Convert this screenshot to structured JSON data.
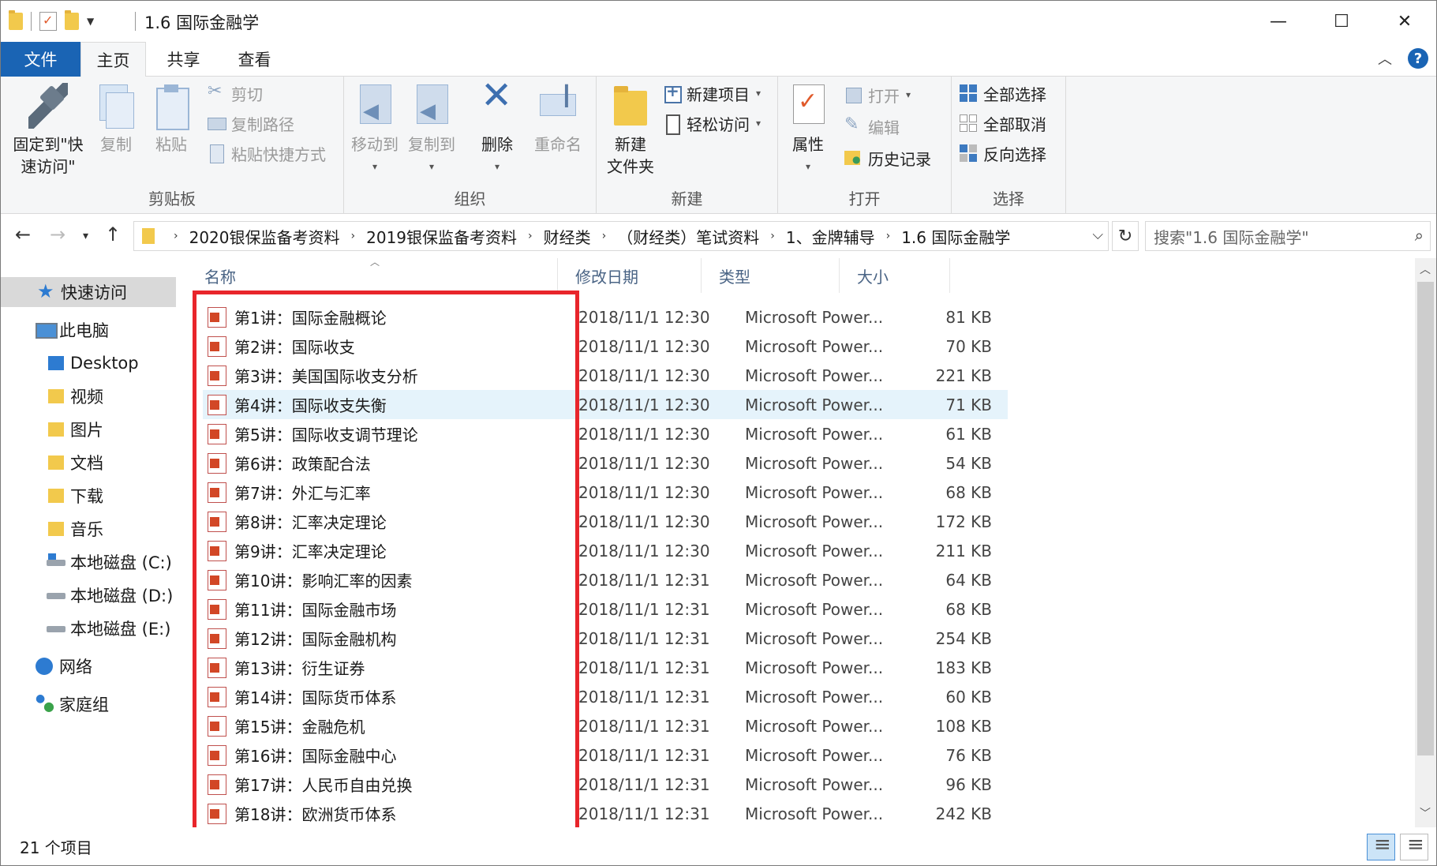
{
  "window": {
    "title": "1.6 国际金融学",
    "controls": {
      "minimize": "—",
      "maximize": "☐",
      "close": "✕"
    }
  },
  "ribbon_tabs": {
    "file": "文件",
    "home": "主页",
    "share": "共享",
    "view": "查看"
  },
  "ribbon": {
    "clipboard": {
      "label": "剪贴板",
      "pin": "固定到\"快速访问\"",
      "copy": "复制",
      "paste": "粘贴",
      "cut": "剪切",
      "copy_path": "复制路径",
      "paste_shortcut": "粘贴快捷方式"
    },
    "organize": {
      "label": "组织",
      "move_to": "移动到",
      "copy_to": "复制到",
      "delete": "删除",
      "rename": "重命名"
    },
    "new": {
      "label": "新建",
      "new_folder": "新建\n文件夹",
      "new_item": "新建项目",
      "easy_access": "轻松访问"
    },
    "open": {
      "label": "打开",
      "properties": "属性",
      "open": "打开",
      "edit": "编辑",
      "history": "历史记录"
    },
    "select": {
      "label": "选择",
      "select_all": "全部选择",
      "select_none": "全部取消",
      "invert": "反向选择"
    }
  },
  "address": {
    "breadcrumbs": [
      "2020银保监备考资料",
      "2019银保监备考资料",
      "财经类",
      "（财经类）笔试资料",
      "1、金牌辅导",
      "1.6 国际金融学"
    ],
    "search_placeholder": "搜索\"1.6 国际金融学\""
  },
  "nav_pane": {
    "quick_access": "快速访问",
    "this_pc": "此电脑",
    "desktop": "Desktop",
    "videos": "视频",
    "pictures": "图片",
    "documents": "文档",
    "downloads": "下载",
    "music": "音乐",
    "drive_c": "本地磁盘 (C:)",
    "drive_d": "本地磁盘 (D:)",
    "drive_e": "本地磁盘 (E:)",
    "network": "网络",
    "homegroup": "家庭组"
  },
  "columns": {
    "name": "名称",
    "modified": "修改日期",
    "type": "类型",
    "size": "大小"
  },
  "files": [
    {
      "name": "第1讲：国际金融概论",
      "date": "2018/11/1 12:30",
      "type": "Microsoft Power...",
      "size": "81 KB"
    },
    {
      "name": "第2讲：国际收支",
      "date": "2018/11/1 12:30",
      "type": "Microsoft Power...",
      "size": "70 KB"
    },
    {
      "name": "第3讲：美国国际收支分析",
      "date": "2018/11/1 12:30",
      "type": "Microsoft Power...",
      "size": "221 KB"
    },
    {
      "name": "第4讲：国际收支失衡",
      "date": "2018/11/1 12:30",
      "type": "Microsoft Power...",
      "size": "71 KB"
    },
    {
      "name": "第5讲：国际收支调节理论",
      "date": "2018/11/1 12:30",
      "type": "Microsoft Power...",
      "size": "61 KB"
    },
    {
      "name": "第6讲：政策配合法",
      "date": "2018/11/1 12:30",
      "type": "Microsoft Power...",
      "size": "54 KB"
    },
    {
      "name": "第7讲：外汇与汇率",
      "date": "2018/11/1 12:30",
      "type": "Microsoft Power...",
      "size": "68 KB"
    },
    {
      "name": "第8讲：汇率决定理论",
      "date": "2018/11/1 12:30",
      "type": "Microsoft Power...",
      "size": "172 KB"
    },
    {
      "name": "第9讲：汇率决定理论",
      "date": "2018/11/1 12:30",
      "type": "Microsoft Power...",
      "size": "211 KB"
    },
    {
      "name": "第10讲：影响汇率的因素",
      "date": "2018/11/1 12:31",
      "type": "Microsoft Power...",
      "size": "64 KB"
    },
    {
      "name": "第11讲：国际金融市场",
      "date": "2018/11/1 12:31",
      "type": "Microsoft Power...",
      "size": "68 KB"
    },
    {
      "name": "第12讲：国际金融机构",
      "date": "2018/11/1 12:31",
      "type": "Microsoft Power...",
      "size": "254 KB"
    },
    {
      "name": "第13讲：衍生证券",
      "date": "2018/11/1 12:31",
      "type": "Microsoft Power...",
      "size": "183 KB"
    },
    {
      "name": "第14讲：国际货币体系",
      "date": "2018/11/1 12:31",
      "type": "Microsoft Power...",
      "size": "60 KB"
    },
    {
      "name": "第15讲：金融危机",
      "date": "2018/11/1 12:31",
      "type": "Microsoft Power...",
      "size": "108 KB"
    },
    {
      "name": "第16讲：国际金融中心",
      "date": "2018/11/1 12:31",
      "type": "Microsoft Power...",
      "size": "76 KB"
    },
    {
      "name": "第17讲：人民币自由兑换",
      "date": "2018/11/1 12:31",
      "type": "Microsoft Power...",
      "size": "96 KB"
    },
    {
      "name": "第18讲：欧洲货币体系",
      "date": "2018/11/1 12:31",
      "type": "Microsoft Power...",
      "size": "242 KB"
    }
  ],
  "status": {
    "item_count": "21 个项目"
  },
  "colors": {
    "accent": "#1a64b4",
    "highlight_row": "#e5f3fb",
    "annotation_box": "#e8252b"
  }
}
